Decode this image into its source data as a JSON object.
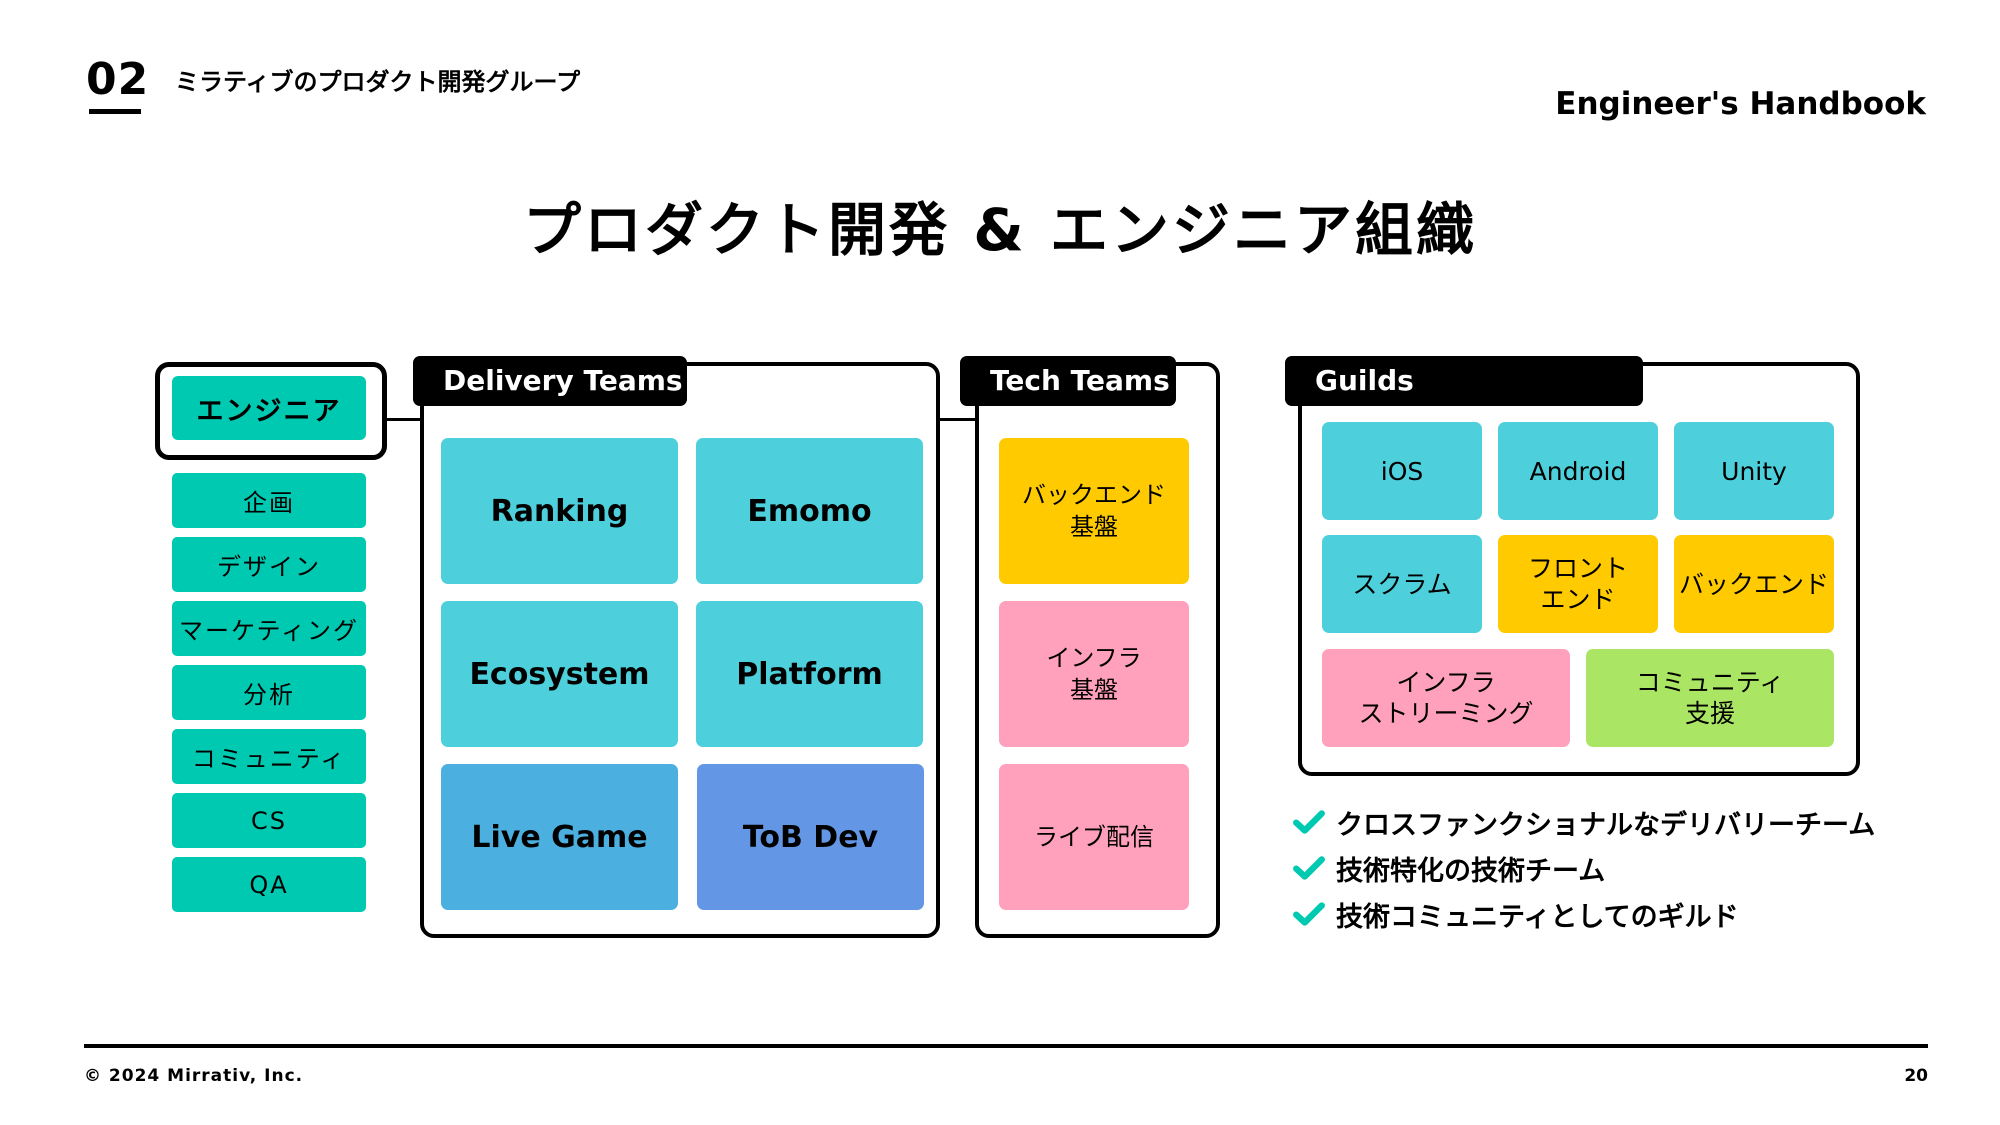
{
  "header": {
    "section_number": "02",
    "section_title": "ミラティブのプロダクト開発グループ",
    "brand": "Engineer's Handbook"
  },
  "title": "プロダクト開発 & エンジニア組織",
  "colors": {
    "teal": "#00c9b1",
    "cyan": "#4dd0db",
    "sky": "#4bb0df",
    "blue": "#6496e6",
    "yellow": "#ffcb00",
    "pink": "#ffa0bc",
    "green": "#aae664",
    "black": "#000000"
  },
  "roles": {
    "highlight": "エンジニア",
    "items": [
      "企画",
      "デザイン",
      "マーケティング",
      "分析",
      "コミュニティ",
      "CS",
      "QA"
    ]
  },
  "delivery_teams": {
    "label": "Delivery Teams",
    "teams": [
      {
        "name": "Ranking",
        "color": "#4dd0db"
      },
      {
        "name": "Emomo",
        "color": "#4dd0db"
      },
      {
        "name": "Ecosystem",
        "color": "#4dd0db"
      },
      {
        "name": "Platform",
        "color": "#4dd0db"
      },
      {
        "name": "Live Game",
        "color": "#4bb0df"
      },
      {
        "name": "ToB Dev",
        "color": "#6496e6"
      }
    ]
  },
  "tech_teams": {
    "label": "Tech Teams",
    "teams": [
      {
        "line1": "バックエンド",
        "line2": "基盤",
        "color": "#ffcb00"
      },
      {
        "line1": "インフラ",
        "line2": "基盤",
        "color": "#ffa0bc"
      },
      {
        "line1": "ライブ配信",
        "line2": "",
        "color": "#ffa0bc"
      }
    ]
  },
  "guilds": {
    "label": "Guilds",
    "row1": [
      {
        "line1": "iOS",
        "line2": "",
        "color": "#4dd0db"
      },
      {
        "line1": "Android",
        "line2": "",
        "color": "#4dd0db"
      },
      {
        "line1": "Unity",
        "line2": "",
        "color": "#4dd0db"
      }
    ],
    "row2": [
      {
        "line1": "スクラム",
        "line2": "",
        "color": "#4dd0db"
      },
      {
        "line1": "フロント",
        "line2": "エンド",
        "color": "#ffcb00"
      },
      {
        "line1": "バックエンド",
        "line2": "",
        "color": "#ffcb00"
      }
    ],
    "row3": [
      {
        "line1": "インフラ",
        "line2": "ストリーミング",
        "color": "#ffa0bc"
      },
      {
        "line1": "コミュニティ",
        "line2": "支援",
        "color": "#aae664"
      }
    ]
  },
  "points": [
    {
      "icon": "check-icon",
      "text": "クロスファンクショナルなデリバリーチーム"
    },
    {
      "icon": "check-icon",
      "text": "技術特化の技術チーム"
    },
    {
      "icon": "check-icon",
      "text": "技術コミュニティとしてのギルド"
    }
  ],
  "footer": {
    "copyright": "© 2024 Mirrativ, Inc.",
    "page_number": "20"
  }
}
